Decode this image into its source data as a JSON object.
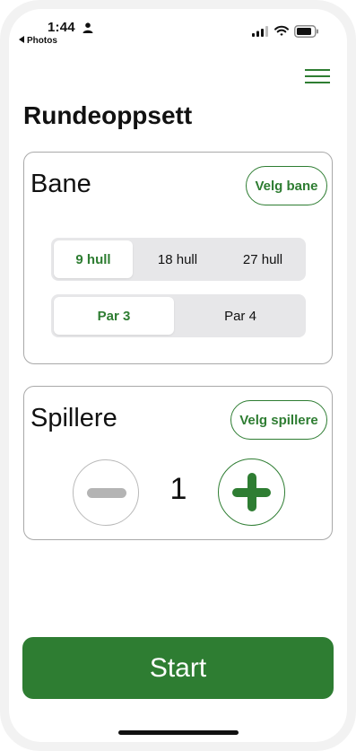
{
  "status_bar": {
    "time": "1:44",
    "back_app": "Photos"
  },
  "page": {
    "title": "Rundeoppsett"
  },
  "course_card": {
    "title": "Bane",
    "select_button": "Velg bane",
    "holes": {
      "options": [
        "9 hull",
        "18 hull",
        "27 hull"
      ],
      "selected": "9 hull"
    },
    "par": {
      "options": [
        "Par 3",
        "Par 4"
      ],
      "selected": "Par 3"
    }
  },
  "players_card": {
    "title": "Spillere",
    "select_button": "Velg spillere",
    "count": "1"
  },
  "start_button": "Start",
  "colors": {
    "accent": "#2e7d32",
    "card_border": "#a9a9a9",
    "segment_bg": "#e7e7e9",
    "disabled": "#b4b4b4"
  }
}
